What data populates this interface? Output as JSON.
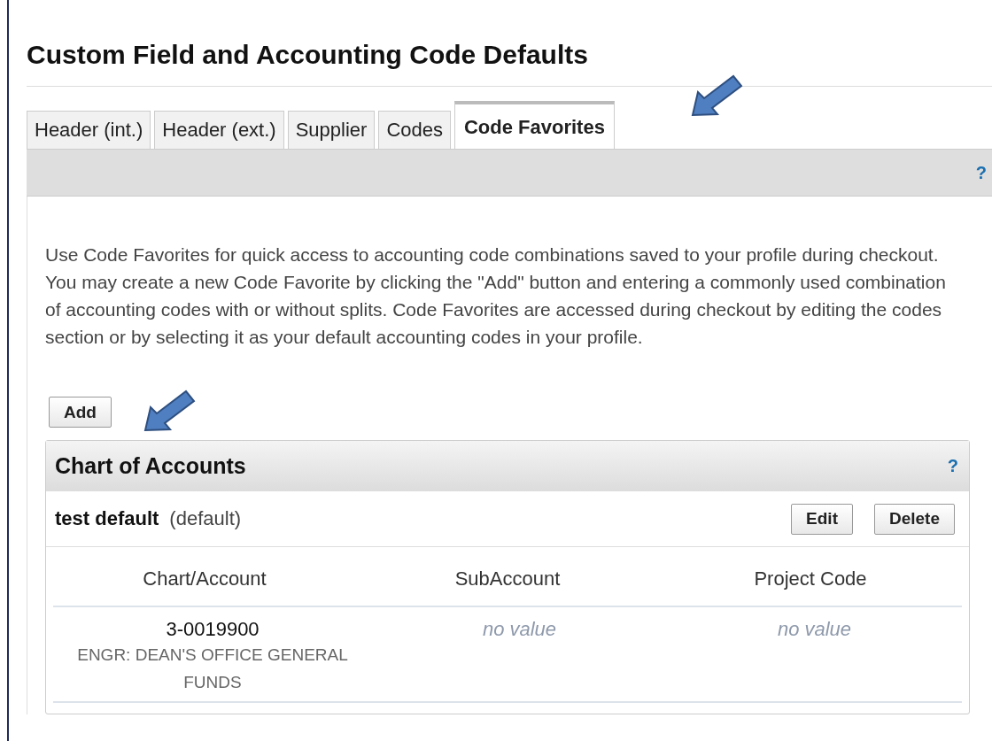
{
  "page": {
    "title": "Custom Field and Accounting Code Defaults"
  },
  "tabs": [
    {
      "label": "Header (int.)",
      "selected": false
    },
    {
      "label": "Header (ext.)",
      "selected": false
    },
    {
      "label": "Supplier",
      "selected": false
    },
    {
      "label": "Codes",
      "selected": false
    },
    {
      "label": "Code Favorites",
      "selected": true
    }
  ],
  "toolbar": {
    "help": "?"
  },
  "description": "Use Code Favorites for quick access to accounting code combinations saved to your profile during checkout. You may create a new Code Favorite by clicking the \"Add\" button and entering a commonly used combination of accounting codes with or without splits. Code Favorites are accessed during checkout by editing the codes section or by selecting it as your default accounting codes in your profile.",
  "add_button": "Add",
  "panel": {
    "title": "Chart of Accounts",
    "help": "?",
    "favorite": {
      "name": "test default",
      "tag": "(default)",
      "buttons": [
        "Edit",
        "Delete"
      ]
    },
    "columns": [
      "Chart/Account",
      "SubAccount",
      "Project Code"
    ],
    "rows": [
      [
        {
          "kind": "value",
          "value": "3-0019900",
          "description": "ENGR: DEAN'S OFFICE GENERAL FUNDS"
        },
        {
          "kind": "empty",
          "value": "no value"
        },
        {
          "kind": "empty",
          "value": "no value"
        }
      ]
    ]
  }
}
